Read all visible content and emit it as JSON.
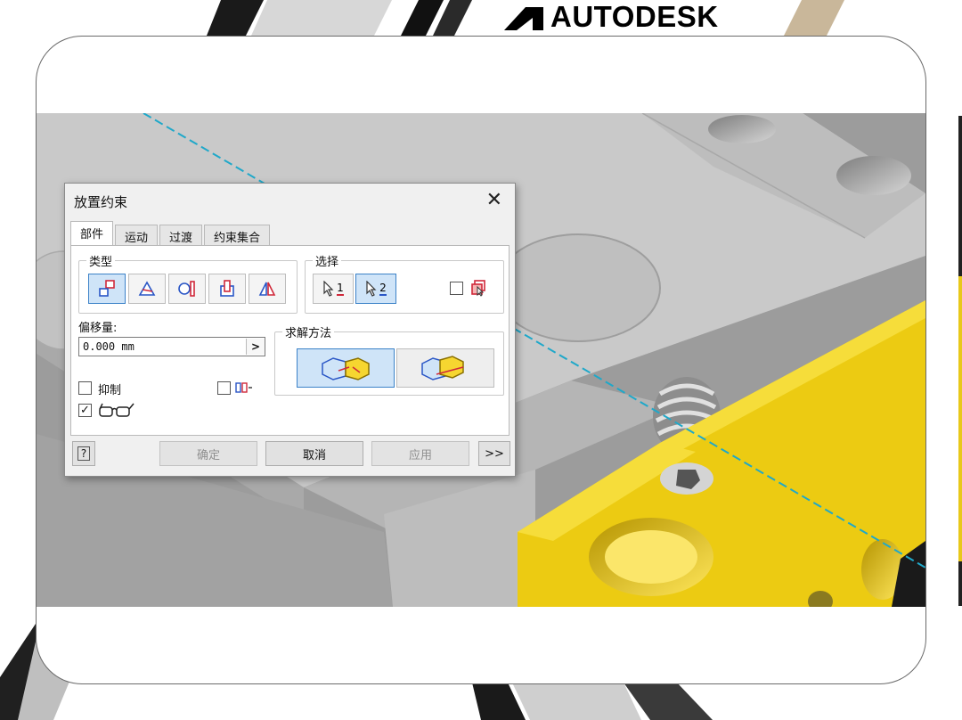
{
  "brand": {
    "name": "AUTODESK"
  },
  "dialog": {
    "title": "放置约束",
    "close_glyph": "✕",
    "tabs": [
      {
        "label": "部件",
        "active": true
      },
      {
        "label": "运动",
        "active": false
      },
      {
        "label": "过渡",
        "active": false
      },
      {
        "label": "约束集合",
        "active": false
      }
    ],
    "type_group": {
      "label": "类型",
      "buttons": [
        {
          "icon": "mate-icon",
          "selected": true
        },
        {
          "icon": "angle-icon",
          "selected": false
        },
        {
          "icon": "tangent-icon",
          "selected": false
        },
        {
          "icon": "insert-icon",
          "selected": false
        },
        {
          "icon": "symmetry-icon",
          "selected": false
        }
      ]
    },
    "selection_group": {
      "label": "选择",
      "sel1_label": "1",
      "sel2_label": "2",
      "sel2_selected": true,
      "pick_part_first_checked": false
    },
    "offset": {
      "label": "偏移量:",
      "value": "0.000 mm",
      "arrow": ">"
    },
    "solution_group": {
      "label": "求解方法",
      "options": [
        {
          "icon": "mate-solution-icon",
          "selected": true
        },
        {
          "icon": "flush-solution-icon",
          "selected": false
        }
      ]
    },
    "suppress": {
      "label": "抑制",
      "checked": false
    },
    "predict_offset": {
      "checked": false
    },
    "show_preview": {
      "checked": true,
      "check_glyph": "✓"
    },
    "buttons": {
      "help": "?",
      "ok": "确定",
      "cancel": "取消",
      "apply": "应用",
      "more": ">>"
    }
  },
  "colors": {
    "accent_blue": "#3c82c8",
    "selection_bg": "#cfe4f8",
    "part_yellow": "#f0cf18",
    "part_grey": "#bdbdbd"
  }
}
